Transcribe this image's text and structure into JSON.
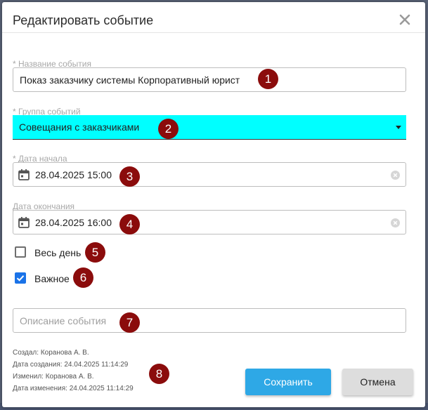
{
  "dialog": {
    "title": "Редактировать событие",
    "close_glyph": "close-icon"
  },
  "form": {
    "event_name": {
      "label": "* Название события",
      "value": "Показ заказчику системы Корпоративный юрист"
    },
    "event_group": {
      "label": "* Группа событий",
      "value": "Совещания с заказчиками",
      "highlight_color": "#00ffff"
    },
    "start_date": {
      "label": "* Дата начала",
      "value": "28.04.2025 15:00"
    },
    "end_date": {
      "label": "Дата окончания",
      "value": "28.04.2025 16:00"
    },
    "all_day": {
      "label": "Весь день",
      "checked": false
    },
    "important": {
      "label": "Важное",
      "checked": true
    },
    "description": {
      "placeholder": "Описание события",
      "value": ""
    }
  },
  "meta": {
    "created_by": "Создал: Коранова А. В.",
    "created_at": "Дата создания: 24.04.2025 11:14:29",
    "modified_by": "Изменил: Коранова А. В.",
    "modified_at": "Дата изменения: 24.04.2025 11:14:29"
  },
  "buttons": {
    "save": "Сохранить",
    "cancel": "Отмена",
    "save_color": "#2ea8e6"
  },
  "annotations": [
    "1",
    "2",
    "3",
    "4",
    "5",
    "6",
    "7",
    "8"
  ],
  "annotation_color": "#8b0c0c"
}
